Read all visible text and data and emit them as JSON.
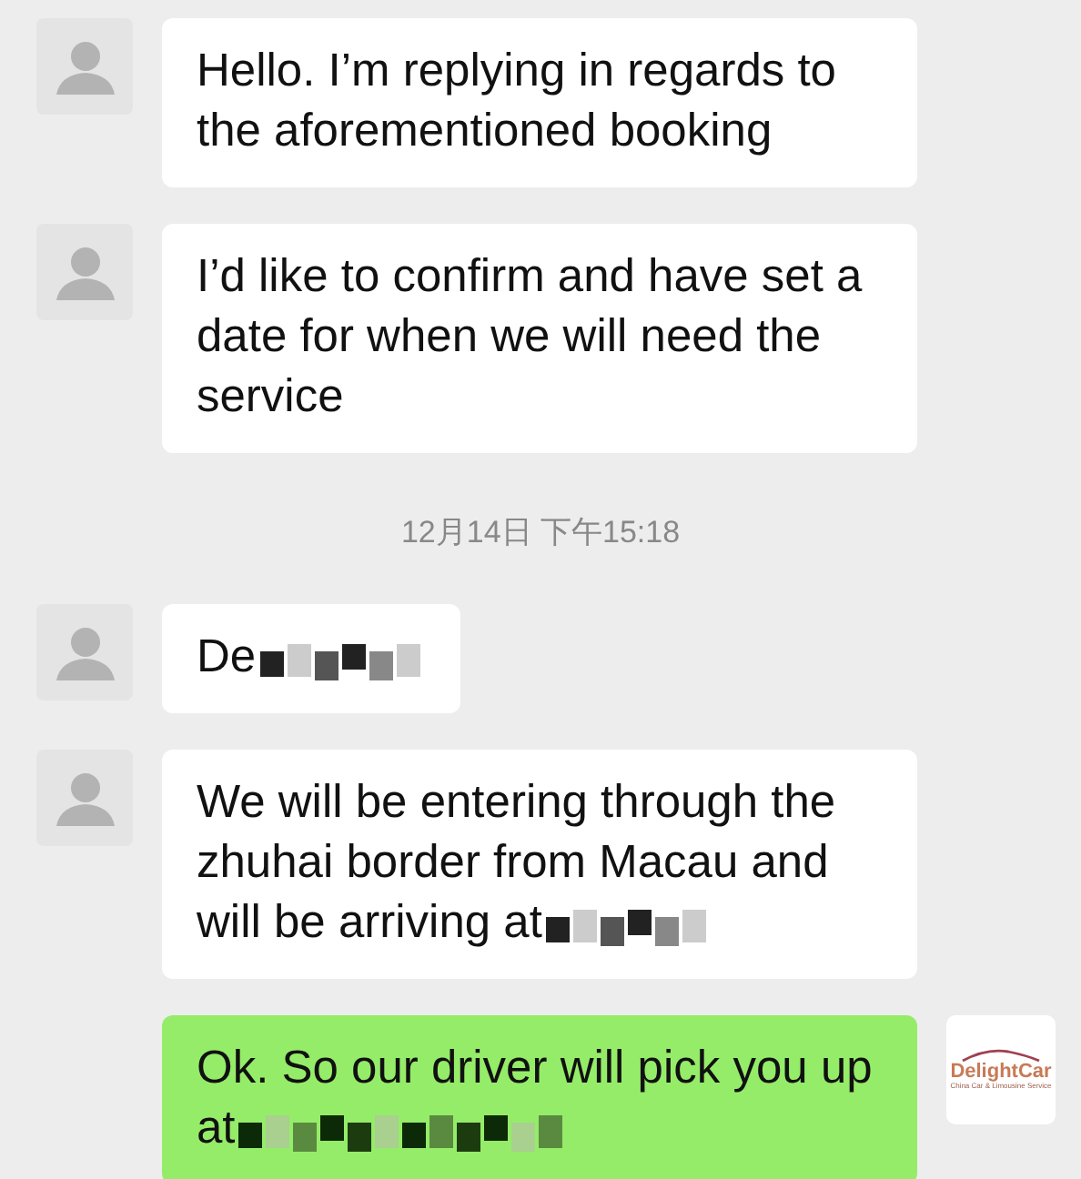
{
  "messages": [
    {
      "kind": "received",
      "text": "Hello. I’m replying in regards to the aforementioned booking",
      "redacted": false
    },
    {
      "kind": "received",
      "text": "I’d like to confirm and have set a date for when we will need the service",
      "redacted": false
    },
    {
      "kind": "timestamp",
      "text": "12月14日 下午15:18"
    },
    {
      "kind": "received",
      "text": "De",
      "redacted": true
    },
    {
      "kind": "received",
      "text": "We will be entering through the zhuhai border from Macau and will be arriving at",
      "redacted": true
    },
    {
      "kind": "sent",
      "text": "Ok. So our driver will pick you up at",
      "redacted": true,
      "avatar": {
        "brand": "DelightCar",
        "tagline": "China Car & Limousine Service"
      }
    }
  ]
}
